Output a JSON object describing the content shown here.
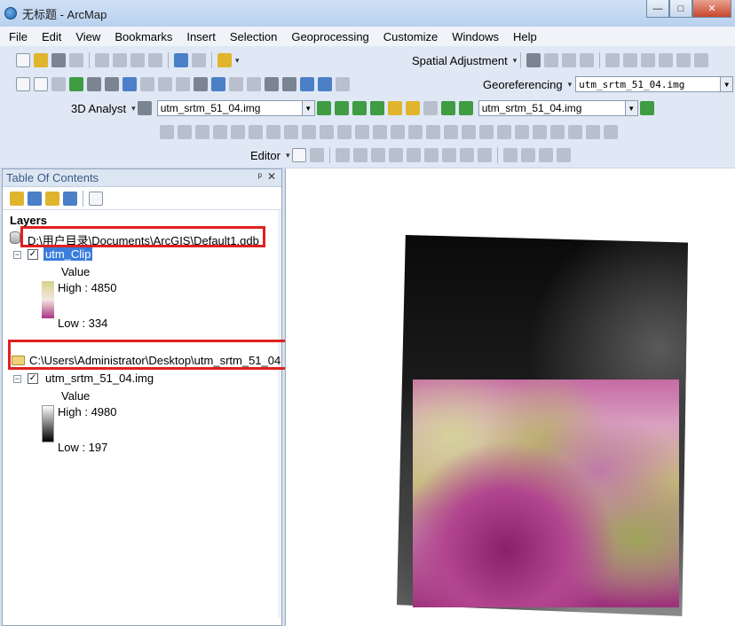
{
  "window": {
    "title": "无标题 - ArcMap",
    "minimize": "—",
    "maximize": "□",
    "close": "✕"
  },
  "menu": [
    "File",
    "Edit",
    "View",
    "Bookmarks",
    "Insert",
    "Selection",
    "Geoprocessing",
    "Customize",
    "Windows",
    "Help"
  ],
  "toolbars": {
    "spatial_adjustment": "Spatial Adjustment",
    "georeferencing": "Georeferencing",
    "georef_layer": "utm_srtm_51_04.img",
    "analyst_3d": "3D Analyst",
    "analyst_layer": "utm_srtm_51_04.img",
    "analyst_layer_2": "utm_srtm_51_04.img",
    "editor": "Editor"
  },
  "toc": {
    "title": "Table Of Contents",
    "pin": "ᵖ",
    "close": "✕",
    "root": "Layers",
    "groups": [
      {
        "path": "D:\\用户目录\\Documents\\ArcGIS\\Default1.gdb",
        "layer": "utm_Clip",
        "checked": "✓",
        "legend_title": "Value",
        "high": "High : 4850",
        "low": "Low : 334"
      },
      {
        "path": "C:\\Users\\Administrator\\Desktop\\utm_srtm_51_04",
        "layer": "utm_srtm_51_04.img",
        "checked": "✓",
        "legend_title": "Value",
        "high": "High : 4980",
        "low": "Low : 197"
      }
    ]
  },
  "colors": {
    "clip_ramp": [
      "#d6d18c",
      "#f2e6e4",
      "#a7357f"
    ],
    "dem_ramp": [
      "#ffffff",
      "#000000"
    ],
    "highlight": "#e02020"
  }
}
